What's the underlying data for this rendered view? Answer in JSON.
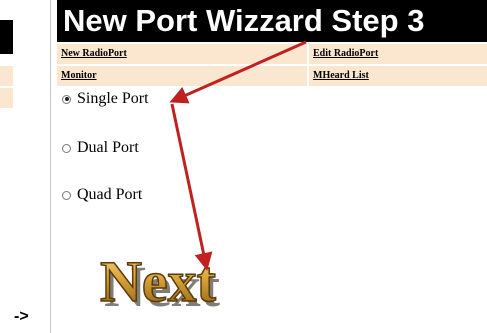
{
  "header": {
    "title": "New Port Wizzard Step 3"
  },
  "menu": {
    "new_radioport": "New RadioPort",
    "edit_radioport": "Edit RadioPort",
    "monitor": "Monitor",
    "mheard_list": "MHeard List"
  },
  "options": [
    {
      "label": "Single Port",
      "selected": true
    },
    {
      "label": "Dual Port",
      "selected": false
    },
    {
      "label": "Quad Port",
      "selected": false
    }
  ],
  "next_button": {
    "text": "Next"
  },
  "left_panel": {
    "arrow_text": "->"
  },
  "colors": {
    "title_bg": "#000000",
    "menu_bg": "#fbe6cf",
    "arrow": "#c0201e",
    "next_gold": "#d9a43a"
  }
}
